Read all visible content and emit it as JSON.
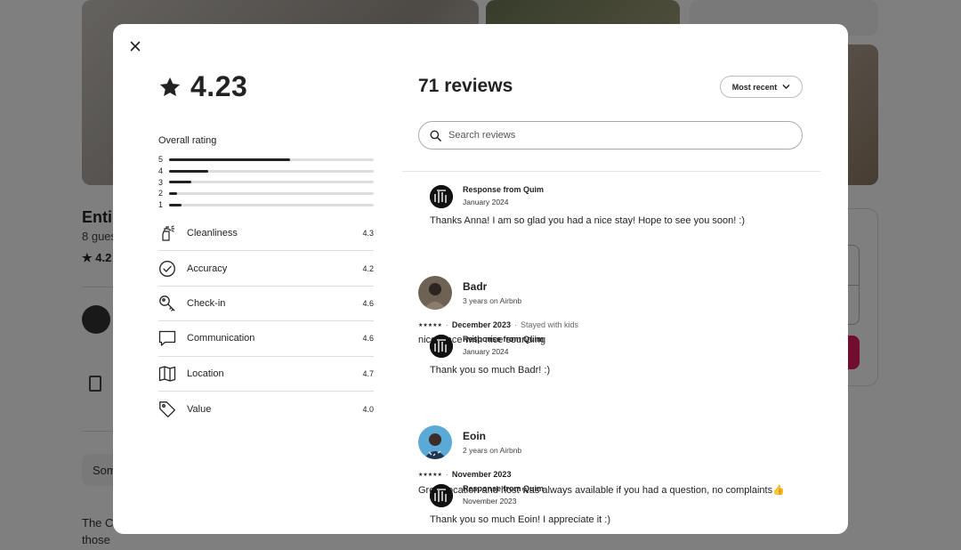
{
  "background": {
    "listing_title": "Entir",
    "guests": "8 gues",
    "rating": "4.2",
    "some_label": "Som",
    "description": "The C bathrooms flat, located at the heart of Barcelona's City Center, perfect for those"
  },
  "modal": {
    "overall_rating": "4.23",
    "overall_label": "Overall rating",
    "distribution": [
      {
        "stars": "5",
        "fraction": 0.59
      },
      {
        "stars": "4",
        "fraction": 0.19
      },
      {
        "stars": "3",
        "fraction": 0.11
      },
      {
        "stars": "2",
        "fraction": 0.04
      },
      {
        "stars": "1",
        "fraction": 0.06
      }
    ],
    "categories": [
      {
        "label": "Cleanliness",
        "score": "4.3",
        "icon": "spray-bottle-icon"
      },
      {
        "label": "Accuracy",
        "score": "4.2",
        "icon": "check-circle-icon"
      },
      {
        "label": "Check-in",
        "score": "4.6",
        "icon": "key-icon"
      },
      {
        "label": "Communication",
        "score": "4.6",
        "icon": "chat-bubble-icon"
      },
      {
        "label": "Location",
        "score": "4.7",
        "icon": "map-icon"
      },
      {
        "label": "Value",
        "score": "4.0",
        "icon": "tag-icon"
      }
    ],
    "review_count": "71 reviews",
    "sort_label": "Most recent",
    "search_placeholder": "Search reviews",
    "first_response": {
      "from": "Response from Quim",
      "date": "January 2024",
      "text": "Thanks Anna! I am so glad you had a nice stay! Hope to see you soon! :)"
    },
    "reviews": [
      {
        "name": "Badr",
        "tenure": "3 years on Airbnb",
        "stars": "★★★★★",
        "date": "December 2023",
        "stay": "Stayed with kids",
        "text": "nice place with nice sounding",
        "response": {
          "from": "Response from Quim",
          "date": "January 2024",
          "text": "Thank you so much Badr! :)"
        }
      },
      {
        "name": "Eoin",
        "tenure": "2 years on Airbnb",
        "stars": "★★★★★",
        "date": "November 2023",
        "text": "Great location and host was always available if you had a question, no complaints👍",
        "response": {
          "from": "Response from Quim",
          "date": "November 2023",
          "text": "Thank you so much Eoin! I appreciate it :)"
        }
      }
    ]
  }
}
